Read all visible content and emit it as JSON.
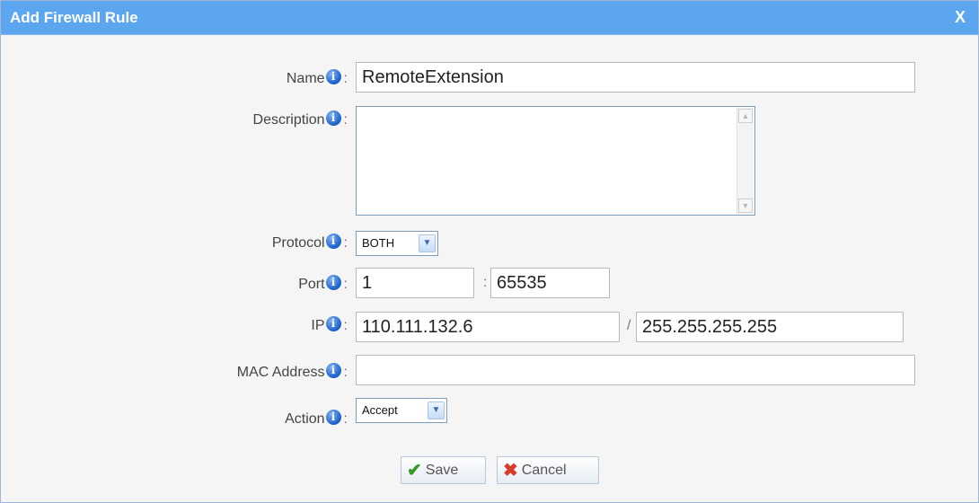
{
  "dialog": {
    "title": "Add Firewall Rule",
    "close_label": "X"
  },
  "form": {
    "name_label": "Name",
    "name_value": "RemoteExtension",
    "description_label": "Description",
    "description_value": "",
    "protocol_label": "Protocol",
    "protocol_value": "BOTH",
    "port_label": "Port",
    "port_start": "1",
    "port_end": "65535",
    "port_separator": ":",
    "ip_label": "IP",
    "ip_value": "110.111.132.6",
    "ip_separator": "/",
    "netmask_value": "255.255.255.255",
    "mac_label": "MAC Address",
    "mac_value": "",
    "action_label": "Action",
    "action_value": "Accept",
    "colon": ":",
    "info_glyph": "i"
  },
  "buttons": {
    "save_label": "Save",
    "cancel_label": "Cancel"
  },
  "icons": {
    "info": "info-icon",
    "save": "check-icon",
    "cancel": "cross-icon",
    "dropdown": "chevron-down-icon"
  },
  "colors": {
    "titlebar": "#5ba6ee",
    "info_icon": "#1a5fc9",
    "save_icon": "#3a9a2b",
    "cancel_icon": "#d93b2b"
  }
}
